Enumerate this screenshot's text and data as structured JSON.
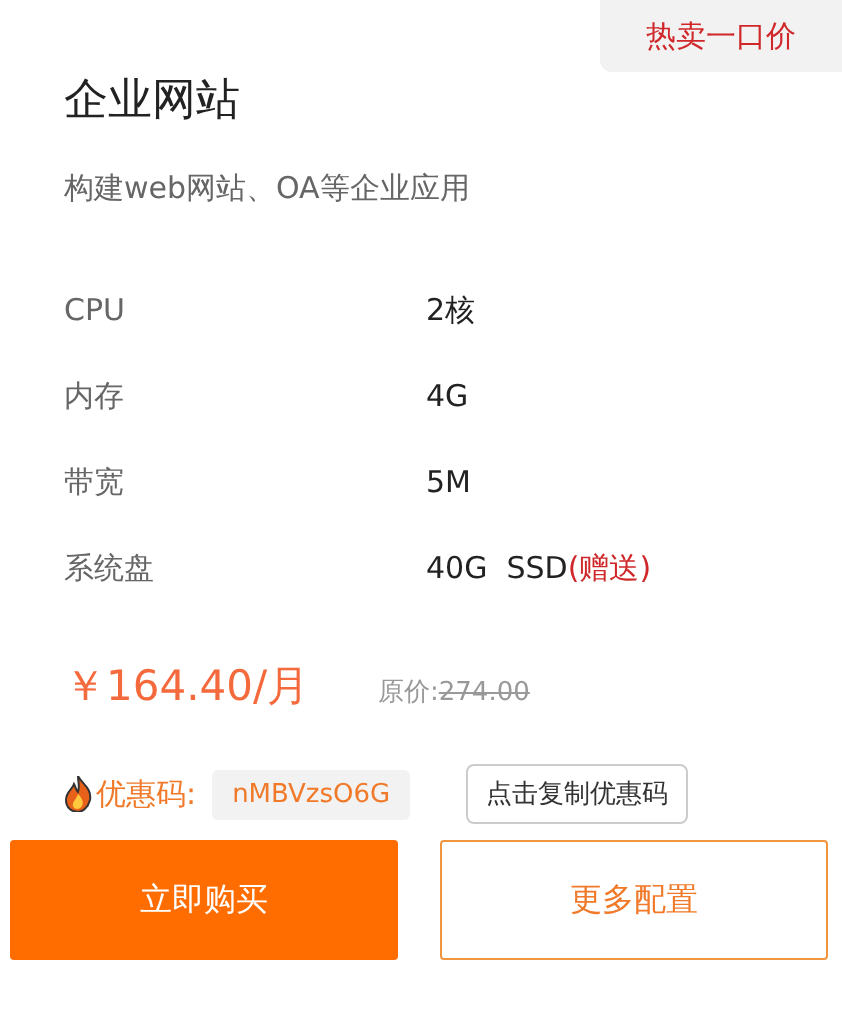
{
  "badge": "热卖一口价",
  "title": "企业网站",
  "subtitle": "构建web网站、OA等企业应用",
  "specs": [
    {
      "label": "CPU",
      "value": "2核"
    },
    {
      "label": "内存",
      "value": "4G"
    },
    {
      "label": "带宽",
      "value": "5M"
    },
    {
      "label": "系统盘",
      "value": "40G  SSD",
      "note": "(赠送)"
    }
  ],
  "price": "￥164.40/月",
  "original_price_label": "原价:",
  "original_price": "274.00",
  "coupon": {
    "label": "优惠码:",
    "code": "nMBVzsO6G",
    "copy_button": "点击复制优惠码"
  },
  "buttons": [
    {
      "label": "立即购买",
      "kind": "primary"
    },
    {
      "label": "更多配置",
      "kind": "outline"
    }
  ]
}
